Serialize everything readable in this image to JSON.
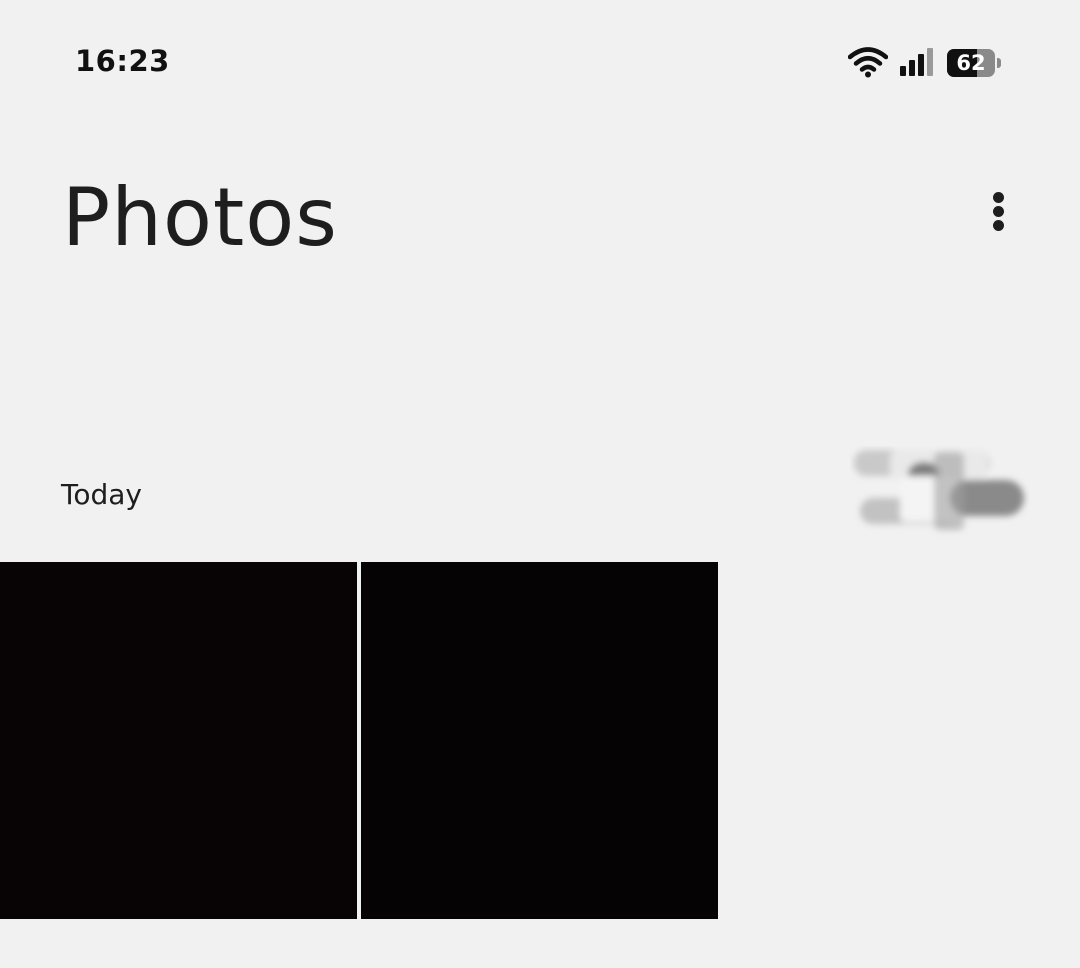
{
  "status_bar": {
    "time": "16:23",
    "wifi_icon": "wifi-icon",
    "signal_icon": "cellular-signal-icon",
    "battery_level": "62",
    "battery_fraction": 0.62
  },
  "header": {
    "title": "Photos",
    "menu_icon": "more-vert-icon"
  },
  "sections": [
    {
      "label": "Today",
      "toggle_icon": "blurred-toggle-icon",
      "photos": [
        {
          "id": "photo-1",
          "color": "#080405"
        },
        {
          "id": "photo-2",
          "color": "#050304"
        }
      ]
    }
  ],
  "colors": {
    "background": "#f1f1f1",
    "text": "#1e1e1e",
    "photo": "#070405"
  }
}
